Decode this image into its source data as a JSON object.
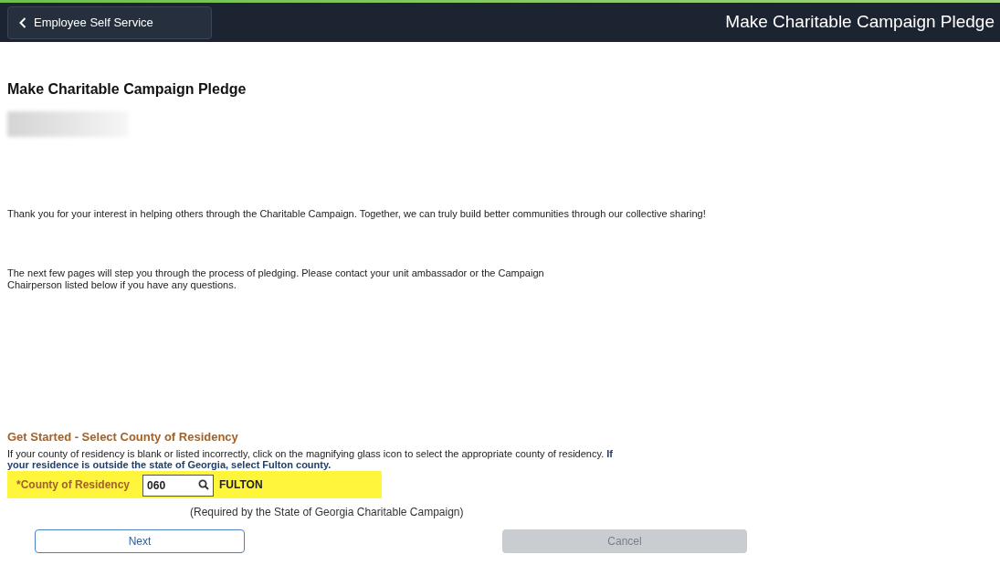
{
  "header": {
    "back_button": "Employee Self Service",
    "title": "Make Charitable Campaign Pledge"
  },
  "page_title": "Make Charitable Campaign Pledge",
  "intro": [
    "Thank you for your interest in helping others through the Charitable Campaign. Together, we can truly build better communities through our collective sharing!",
    "The next few pages will step you through the process of pledging. Please contact your unit ambassador or the Campaign Chairperson listed below if you have any questions."
  ],
  "section": {
    "heading": "Get Started - Select County of Residency",
    "instructions": "If your county of residency is blank or listed incorrectly, click on the magnifying glass icon to select the appropriate county of residency. **If your residence is outside the state of Georgia, select Fulton county.**",
    "field": {
      "label": "*County of Residency",
      "value": "060",
      "description": "FULTON"
    },
    "note": "(Required by the State of Georgia Charitable Campaign)"
  },
  "buttons": [
    {
      "label": "Next",
      "disabled": false
    },
    {
      "label": "Cancel",
      "disabled": true
    }
  ]
}
